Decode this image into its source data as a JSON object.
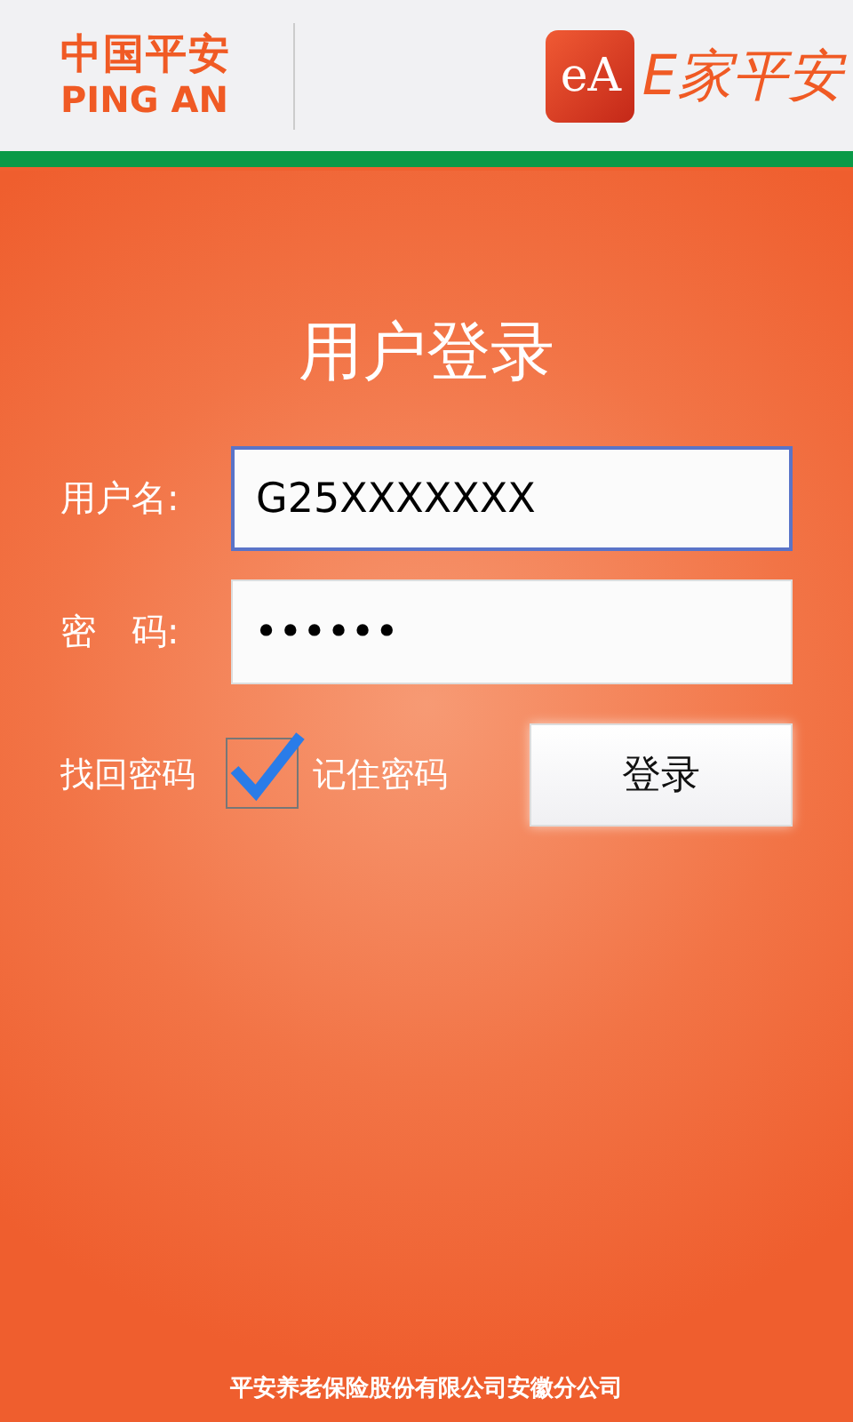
{
  "header": {
    "brand_cn": "中国平安",
    "brand_en": "PING AN",
    "app_logo": "eA",
    "app_name": "E家平安"
  },
  "login": {
    "title": "用户登录",
    "fields": [
      {
        "label": "用户名:",
        "value": "G25XXXXXXX",
        "focused": true
      },
      {
        "label": "密　码:",
        "value": "••••••",
        "focused": false
      }
    ],
    "forgot_link": "找回密码",
    "remember": {
      "label": "记住密码",
      "checked": true
    },
    "submit": "登录"
  },
  "footer": "平安养老保险股份有限公司安徽分公司"
}
